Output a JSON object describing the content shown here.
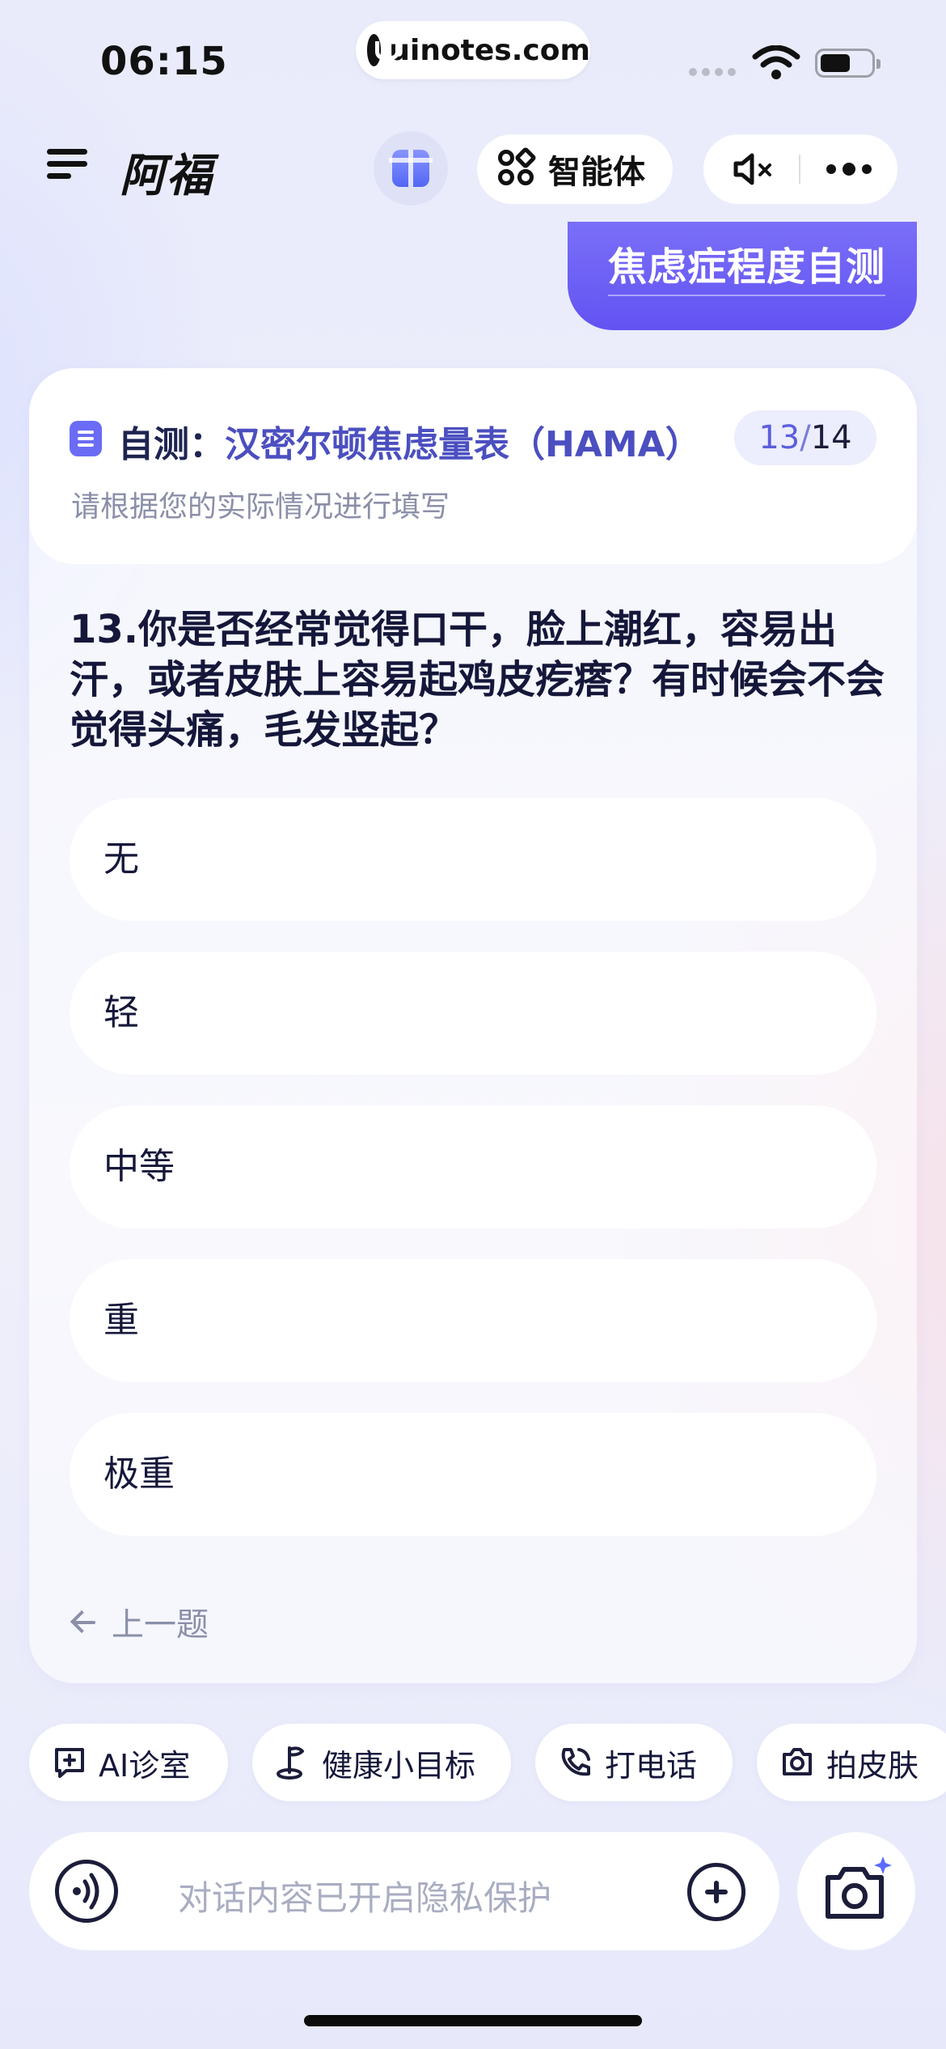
{
  "status_bar": {
    "time": "06:15",
    "url": "uinotes.com"
  },
  "header": {
    "title": "阿福",
    "agent_label": "智能体",
    "icons": [
      "menu-icon",
      "gift-icon",
      "agent-grid-icon",
      "sound-mute-icon",
      "more-icon"
    ]
  },
  "user_message": "焦虑症程度自测",
  "card": {
    "title_prefix": "自测：",
    "title_name": "汉密尔顿焦虑量表（HAMA）",
    "progress_current": "13",
    "progress_separator": "/",
    "progress_total": "14",
    "subtitle": "请根据您的实际情况进行填写",
    "question": "13.你是否经常觉得口干，脸上潮红，容易出汗，或者皮肤上容易起鸡皮疙瘩？有时候会不会觉得头痛，毛发竖起？",
    "options": [
      "无",
      "轻",
      "中等",
      "重",
      "极重"
    ],
    "prev_label": "上一题"
  },
  "quick_actions": [
    "AI诊室",
    "健康小目标",
    "打电话",
    "拍皮肤"
  ],
  "input": {
    "placeholder": "对话内容已开启隐私保护"
  },
  "colors": {
    "accent": "#6253f2",
    "title_accent": "#4b4fc0",
    "muted_text": "#8b8fa8"
  }
}
